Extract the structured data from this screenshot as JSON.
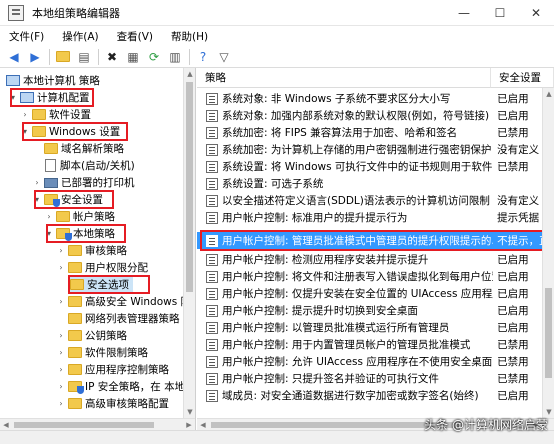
{
  "window": {
    "title": "本地组策略编辑器"
  },
  "menu": [
    "文件(F)",
    "操作(A)",
    "查看(V)",
    "帮助(H)"
  ],
  "toolbar": {
    "buttons": [
      "back-arrow-icon",
      "forward-arrow-icon",
      "up-folder-icon",
      "show-tree-icon",
      "delete-icon",
      "properties-icon",
      "refresh-icon",
      "export-list-icon",
      "help-icon",
      "filter-icon"
    ]
  },
  "tree": {
    "items": [
      {
        "label": "本地计算机 策略"
      },
      {
        "label": "计算机配置"
      },
      {
        "label": "软件设置"
      },
      {
        "label": "Windows 设置"
      },
      {
        "label": "域名解析策略"
      },
      {
        "label": "脚本(启动/关机)"
      },
      {
        "label": "已部署的打印机"
      },
      {
        "label": "安全设置"
      },
      {
        "label": "帐户策略"
      },
      {
        "label": "本地策略"
      },
      {
        "label": "审核策略"
      },
      {
        "label": "用户权限分配"
      },
      {
        "label": "安全选项"
      },
      {
        "label": "高级安全 Windows 防火墙"
      },
      {
        "label": "网络列表管理器策略"
      },
      {
        "label": "公钥策略"
      },
      {
        "label": "软件限制策略"
      },
      {
        "label": "应用程序控制策略"
      },
      {
        "label": "IP 安全策略，在 本地计算机"
      },
      {
        "label": "高级审核策略配置"
      }
    ]
  },
  "list": {
    "columns": {
      "policy": "策略",
      "setting": "安全设置"
    },
    "rows": [
      {
        "name": "系统对象: 非 Windows 子系统不要求区分大小写",
        "value": "已启用"
      },
      {
        "name": "系统对象: 加强内部系统对象的默认权限(例如，符号链接)",
        "value": "已启用"
      },
      {
        "name": "系统加密: 将 FIPS 兼容算法用于加密、哈希和签名",
        "value": "已禁用"
      },
      {
        "name": "系统加密: 为计算机上存储的用户密钥强制进行强密钥保护",
        "value": "没有定义"
      },
      {
        "name": "系统设置: 将 Windows 可执行文件中的证书规则用于软件限制...",
        "value": "已禁用"
      },
      {
        "name": "系统设置: 可选子系统",
        "value": ""
      },
      {
        "name": "以安全描述符定义语言(SDDL)语法表示的计算机访问限制",
        "value": "没有定义"
      },
      {
        "name": "用户帐户控制: 标准用户的提升提示行为",
        "value": "提示凭据"
      },
      {
        "name": "用户帐户控制: 管理员批准模式中管理员的提升权限提示的...",
        "value": "不提示，直接提升"
      },
      {
        "name": "用户帐户控制: 检测应用程序安装并提示提升",
        "value": "已启用"
      },
      {
        "name": "用户帐户控制: 将文件和注册表写入错误虚拟化到每用户位置",
        "value": "已启用"
      },
      {
        "name": "用户帐户控制: 仅提升安装在安全位置的 UIAccess 应用程序",
        "value": "已启用"
      },
      {
        "name": "用户帐户控制: 提示提升时切换到安全桌面",
        "value": "已启用"
      },
      {
        "name": "用户帐户控制: 以管理员批准模式运行所有管理员",
        "value": "已启用"
      },
      {
        "name": "用户帐户控制: 用于内置管理员帐户的管理员批准模式",
        "value": "已禁用"
      },
      {
        "name": "用户帐户控制: 允许 UIAccess 应用程序在不使用安全桌面的...",
        "value": "已禁用"
      },
      {
        "name": "用户帐户控制: 只提升签名并验证的可执行文件",
        "value": "已禁用"
      },
      {
        "name": "域成员: 对安全通道数据进行数字加密或数字签名(始终)",
        "value": "已启用"
      }
    ]
  },
  "watermark": "头条 @计算机网络启蒙",
  "colors": {
    "highlight_box": "#e51c23",
    "selection": "#3399ff",
    "folder": "#f2c94c"
  }
}
